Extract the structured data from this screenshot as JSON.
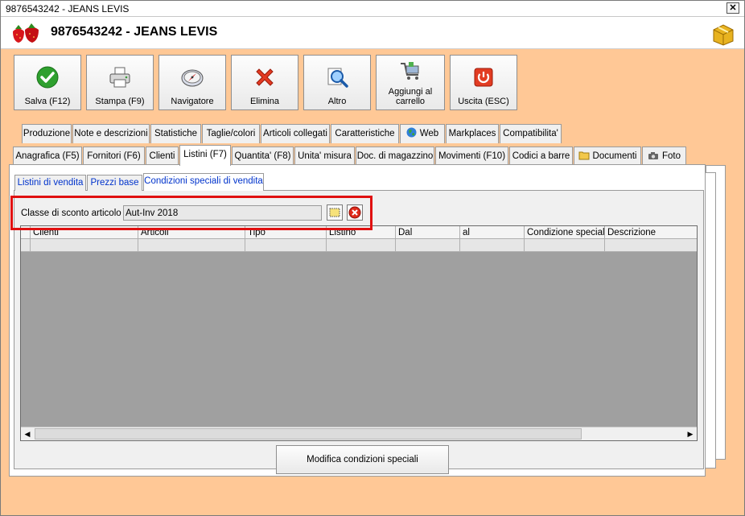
{
  "window": {
    "title": "9876543242 - JEANS LEVIS",
    "close_glyph": "✕"
  },
  "header": {
    "title": "9876543242 - JEANS LEVIS",
    "app_icon": "strawberry-icon",
    "right_icon": "boxes-icon"
  },
  "toolbar": {
    "buttons": [
      {
        "label": "Salva (F12)",
        "icon": "checkmark-icon"
      },
      {
        "label": "Stampa (F9)",
        "icon": "printer-icon"
      },
      {
        "label": "Navigatore",
        "icon": "compass-icon"
      },
      {
        "label": "Elimina",
        "icon": "delete-x-icon"
      },
      {
        "label": "Altro",
        "icon": "magnifier-icon"
      },
      {
        "label": "Aggiungi al carrello",
        "icon": "cart-icon"
      },
      {
        "label": "Uscita (ESC)",
        "icon": "power-icon"
      }
    ]
  },
  "tabs_row1": [
    "Produzione",
    "Note e descrizioni",
    "Statistiche",
    "Taglie/colori",
    "Articoli collegati",
    "Caratteristiche",
    "Web",
    "Markplaces",
    "Compatibilita'"
  ],
  "tabs_row2": [
    "Anagrafica (F5)",
    "Fornitori (F6)",
    "Clienti",
    "Listini (F7)",
    "Quantita' (F8)",
    "Unita' misura",
    "Doc. di magazzino",
    "Movimenti (F10)",
    "Codici a barre",
    "Documenti",
    "Foto"
  ],
  "active_tab": "Listini (F7)",
  "subtabs": [
    "Listini di vendita",
    "Prezzi base",
    "Condizioni speciali di vendita"
  ],
  "active_subtab": "Condizioni speciali di vendita",
  "discount": {
    "label": "Classe di sconto articolo :",
    "value": "Aut-Inv 2018"
  },
  "grid": {
    "columns": [
      "Clienti",
      "Articoli",
      "Tipo",
      "Listino",
      "Dal",
      "al",
      "Condizione speciale",
      "Descrizione"
    ]
  },
  "modify_button": "Modifica condizioni speciali",
  "colors": {
    "background": "#ffc896",
    "highlight": "#e01010",
    "subtab_text": "#0033cc",
    "grid_empty": "#a0a0a0"
  }
}
